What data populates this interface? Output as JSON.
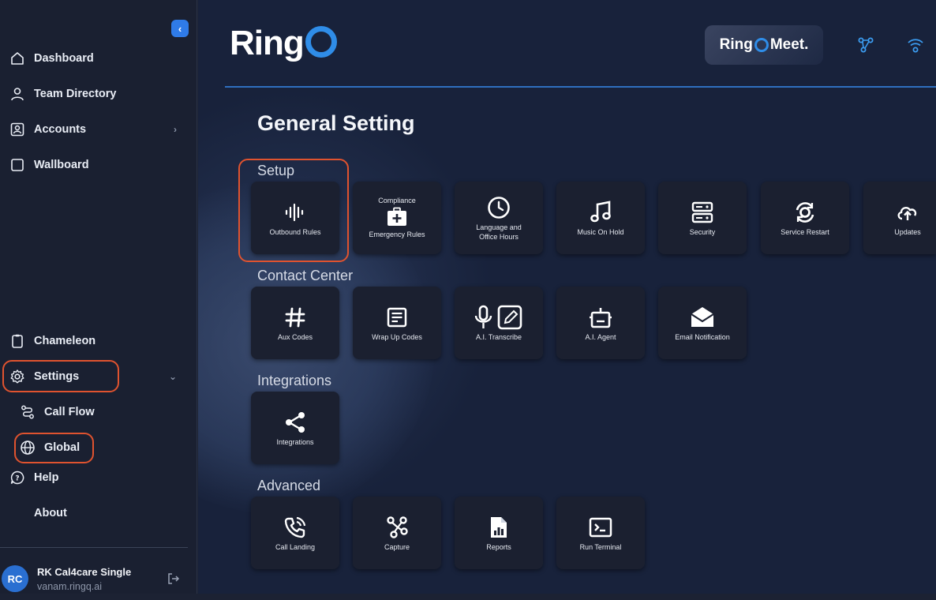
{
  "sidebar": {
    "collapse_icon": "chevron-left-icon",
    "items": [
      {
        "label": "Dashboard",
        "icon": "home-icon"
      },
      {
        "label": "Team Directory",
        "icon": "user-icon"
      },
      {
        "label": "Accounts",
        "icon": "account-card-icon"
      },
      {
        "label": "Wallboard",
        "icon": "square-icon"
      },
      {
        "label": "Chameleon",
        "icon": "clipboard-icon"
      },
      {
        "label": "Settings",
        "icon": "gear-icon"
      },
      {
        "label": "Call Flow",
        "icon": "route-icon"
      },
      {
        "label": "Global",
        "icon": "globe-icon"
      },
      {
        "label": "Help",
        "icon": "help-icon"
      },
      {
        "label": "About",
        "icon": ""
      }
    ],
    "user": {
      "initials": "RC",
      "name": "RK Cal4care Single",
      "host": "vanam.ringq.ai"
    }
  },
  "header": {
    "logo_text": "Ring",
    "meet_text_1": "Ring",
    "meet_text_2": "Meet.",
    "accent": "#2f8de8"
  },
  "page": {
    "title": "General Setting",
    "sections": {
      "setup": "Setup",
      "contact_center": "Contact Center",
      "integrations": "Integrations",
      "advanced": "Advanced"
    },
    "tiles": {
      "outbound_rules": "Outbound Rules",
      "emergency_top": "Compliance",
      "emergency_rules": "Emergency Rules",
      "language_1": "Language and",
      "language_2": "Office Hours",
      "music_on_hold": "Music On Hold",
      "security": "Security",
      "service_restart": "Service Restart",
      "updates": "Updates",
      "aux_codes": "Aux Codes",
      "wrap_up_codes": "Wrap Up Codes",
      "ai_transcribe": "A.I. Transcribe",
      "ai_agent": "A.I. Agent",
      "email_notification": "Email Notification",
      "integrations": "Integrations",
      "call_landing": "Call Landing",
      "capture": "Capture",
      "reports": "Reports",
      "run_terminal": "Run Terminal"
    }
  },
  "colors": {
    "highlight": "#e0532f",
    "accent": "#2f7be8"
  }
}
